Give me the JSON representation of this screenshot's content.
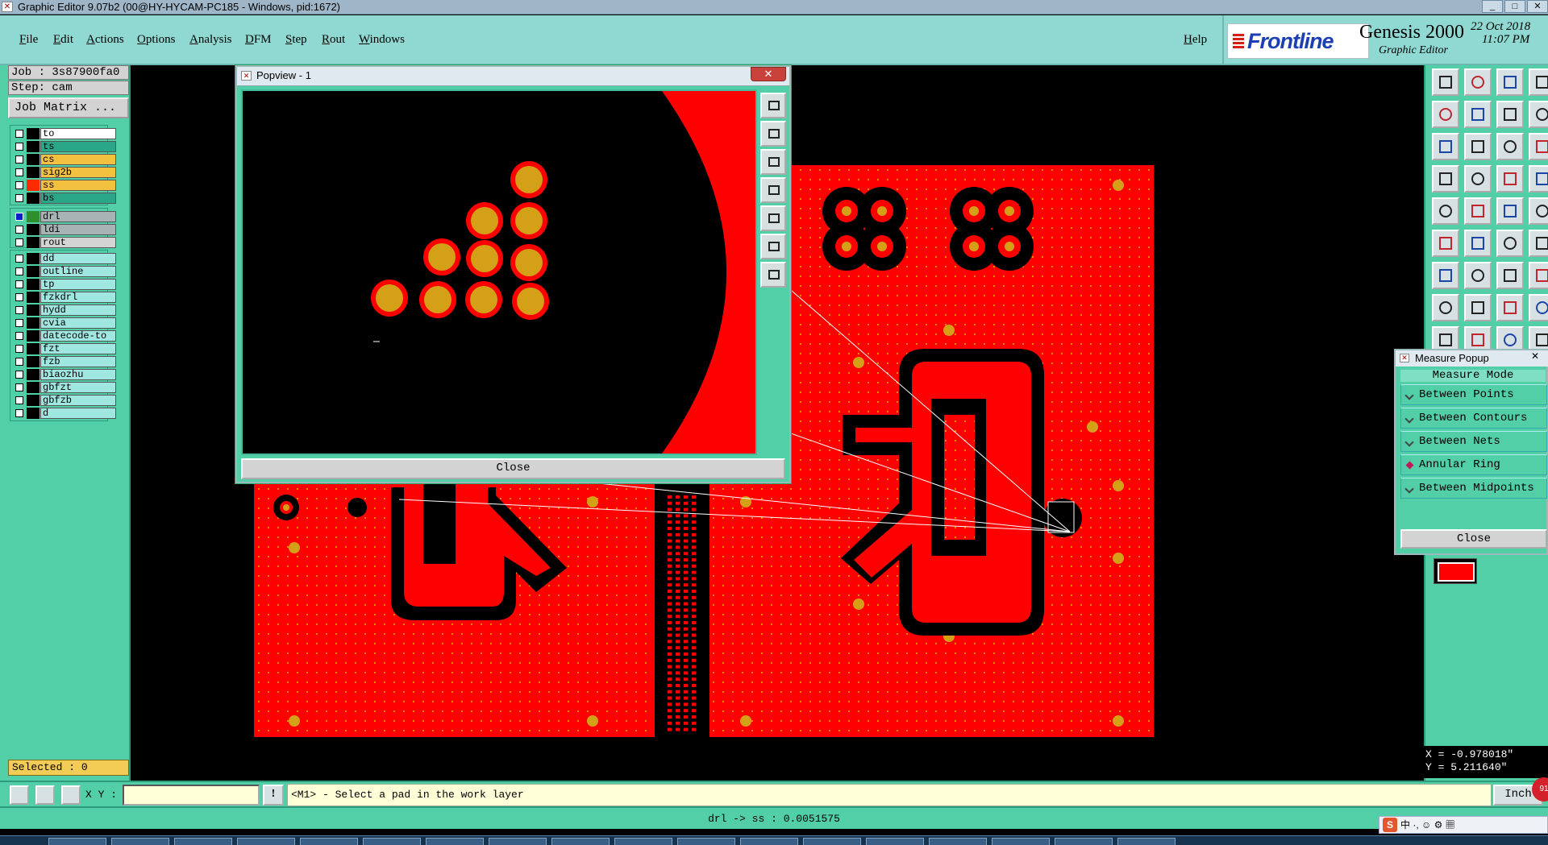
{
  "window": {
    "title": "Graphic Editor 9.07b2 (00@HY-HYCAM-PC185 - Windows, pid:1672)"
  },
  "menu": {
    "items": [
      "File",
      "Edit",
      "Actions",
      "Options",
      "Analysis",
      "DFM",
      "Step",
      "Rout",
      "Windows"
    ],
    "help": "Help"
  },
  "brand": {
    "logo": "Frontline",
    "name": "Genesis 2000",
    "subtitle": "Graphic Editor",
    "date": "22 Oct 2018",
    "time": "11:07 PM"
  },
  "job": {
    "job_label": "Job : 3s87900fa0",
    "step_label": "Step: cam",
    "matrix_button": "Job Matrix ..."
  },
  "layers": {
    "board": [
      {
        "name": "to",
        "color": "#ffffff"
      },
      {
        "name": "ts",
        "color": "#2aa788"
      },
      {
        "name": "cs",
        "color": "#f3c040"
      },
      {
        "name": "sig2b",
        "color": "#f3c040"
      },
      {
        "name": "ss",
        "color": "#f3c040",
        "swatch": "#ff2a00"
      },
      {
        "name": "bs",
        "color": "#2aa788"
      }
    ],
    "drill": [
      {
        "name": "drl",
        "color": "#a8b4b4",
        "swatch": "#2f8f2f",
        "selected": true
      },
      {
        "name": "ldi",
        "color": "#a8b4b4"
      },
      {
        "name": "rout",
        "color": "#d4d4d4"
      }
    ],
    "misc": [
      {
        "name": "dd"
      },
      {
        "name": "outline"
      },
      {
        "name": "tp"
      },
      {
        "name": "fzkdrl"
      },
      {
        "name": "hydd"
      },
      {
        "name": "cvia"
      },
      {
        "name": "datecode-to"
      },
      {
        "name": "fzt"
      },
      {
        "name": "fzb"
      },
      {
        "name": "biaozhu"
      },
      {
        "name": "gbfzt"
      },
      {
        "name": "gbfzb"
      },
      {
        "name": "d"
      }
    ],
    "misc_color": "#9fe7e0"
  },
  "selected": "Selected : 0",
  "popview": {
    "title": "Popview - 1",
    "close": "Close"
  },
  "measure": {
    "title": "Measure Popup",
    "header": "Measure Mode",
    "options": [
      {
        "label": "Between Points",
        "active": false
      },
      {
        "label": "Between Contours",
        "active": false
      },
      {
        "label": "Between Nets",
        "active": false
      },
      {
        "label": "Annular Ring",
        "active": true
      },
      {
        "label": "Between Midpoints",
        "active": false
      }
    ],
    "close": "Close"
  },
  "coords": {
    "x": "X = -0.978018\"",
    "y": "Y = 5.211640\""
  },
  "status": {
    "xy_label": "X Y :",
    "xy_value": "",
    "bang": "!",
    "prompt": "<M1> - Select a pad in the work layer",
    "unit": "Inch",
    "badge": "91"
  },
  "info": {
    "text": "drl -> ss : 0.0051575"
  },
  "tray": {
    "text": "中 ·, ☺ ⚙ ▦"
  },
  "colors": {
    "panel": "#52cfa6",
    "copper": "#ff0000",
    "pad": "#d4a017",
    "mask": "#000000"
  }
}
